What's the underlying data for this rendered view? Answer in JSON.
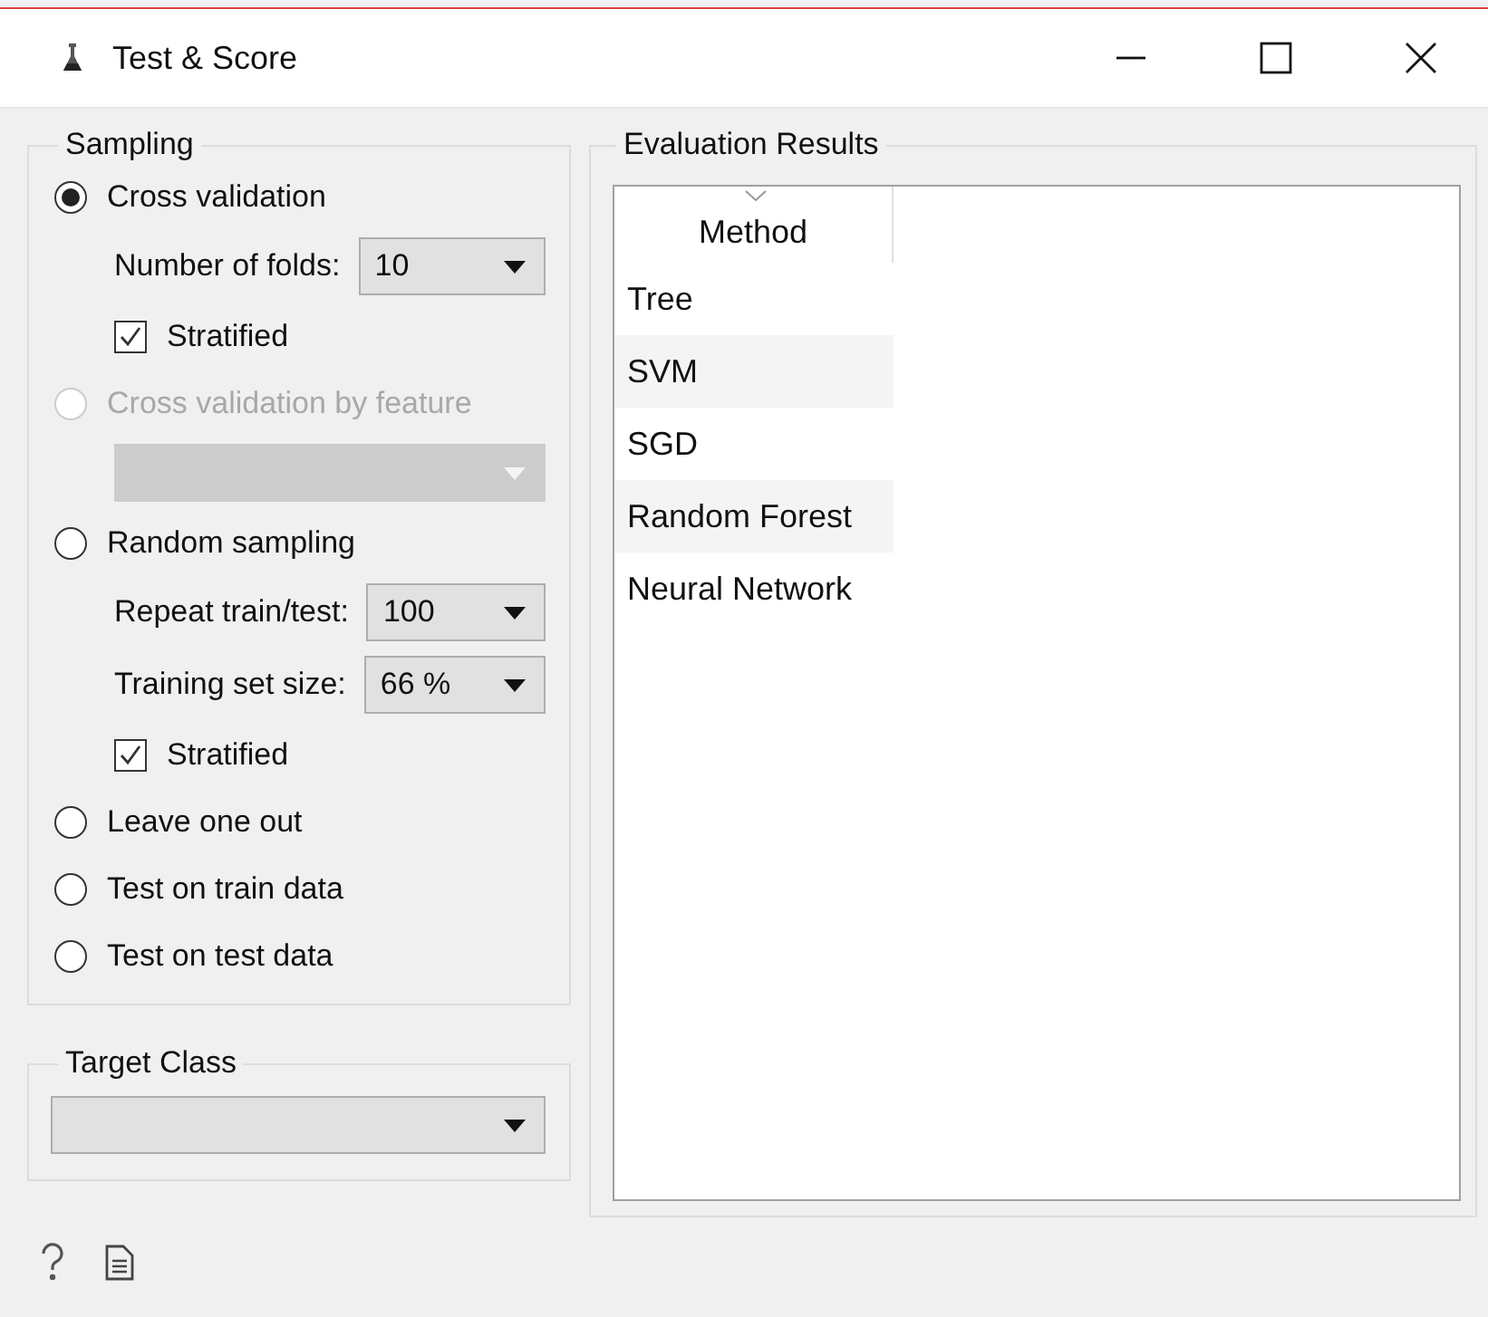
{
  "window": {
    "title": "Test & Score"
  },
  "sampling": {
    "title": "Sampling",
    "options": [
      {
        "kind": "radio",
        "label": "Cross validation",
        "selected": true,
        "disabled": false,
        "children": [
          {
            "kind": "combo",
            "label": "Number of folds:",
            "value": "10",
            "disabled": false
          },
          {
            "kind": "checkbox",
            "label": "Stratified",
            "checked": true
          }
        ]
      },
      {
        "kind": "radio",
        "label": "Cross validation by feature",
        "selected": false,
        "disabled": true,
        "children": [
          {
            "kind": "combo",
            "disabled": true
          }
        ]
      },
      {
        "kind": "radio",
        "label": "Random sampling",
        "selected": false,
        "disabled": false,
        "children": [
          {
            "kind": "combo",
            "label": "Repeat train/test:",
            "value": "100",
            "disabled": false
          },
          {
            "kind": "combo",
            "label": "Training set size:",
            "value": "66 %",
            "disabled": false
          },
          {
            "kind": "checkbox",
            "label": "Stratified",
            "checked": true
          }
        ]
      },
      {
        "kind": "radio",
        "label": "Leave one out",
        "selected": false,
        "disabled": false
      },
      {
        "kind": "radio",
        "label": "Test on train data",
        "selected": false,
        "disabled": false
      },
      {
        "kind": "radio",
        "label": "Test on test data",
        "selected": false,
        "disabled": false
      }
    ]
  },
  "target_class": {
    "title": "Target Class",
    "combo": {
      "disabled": false
    }
  },
  "evaluation_results": {
    "title": "Evaluation Results",
    "table": {
      "columns": [
        "Method"
      ],
      "rows": [
        {
          "method": "Tree"
        },
        {
          "method": "SVM"
        },
        {
          "method": "SGD"
        },
        {
          "method": "Random Forest"
        },
        {
          "method": "Neural Network"
        }
      ]
    }
  }
}
